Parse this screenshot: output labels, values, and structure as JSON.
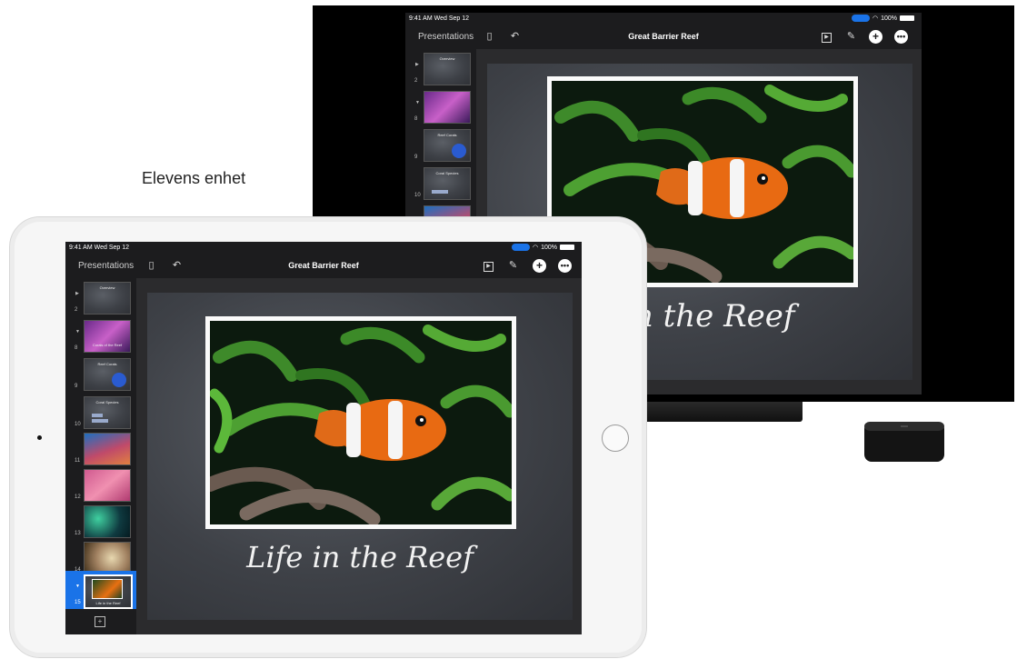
{
  "label": "Elevens enhet",
  "status": {
    "time": "9:41 AM  Wed Sep 12",
    "battery": "100%"
  },
  "toolbar": {
    "presentations": "Presentations",
    "title": "Great Barrier Reef",
    "undo_icon": "undo-icon",
    "sidebar_icon": "sidebar-icon"
  },
  "thumbs": [
    {
      "num": "2",
      "title": "Overview",
      "kind": "chalk"
    },
    {
      "num": "8",
      "title": "Corals of the Reef",
      "kind": "purple"
    },
    {
      "num": "9",
      "title": "Reef Corals",
      "kind": "chalk-blue"
    },
    {
      "num": "10",
      "title": "Coral Species",
      "kind": "chalk-chart"
    },
    {
      "num": "11",
      "title": "",
      "kind": "reef"
    },
    {
      "num": "12",
      "title": "",
      "kind": "pink"
    },
    {
      "num": "13",
      "title": "",
      "kind": "anemone"
    },
    {
      "num": "14",
      "title": "",
      "kind": "coral"
    },
    {
      "num": "15",
      "title": "Life in the Reef",
      "kind": "selected"
    }
  ],
  "slide": {
    "title": "Life in the Reef",
    "title_partial": "in the Reef"
  },
  "colors": {
    "accent": "#1a73e8"
  }
}
